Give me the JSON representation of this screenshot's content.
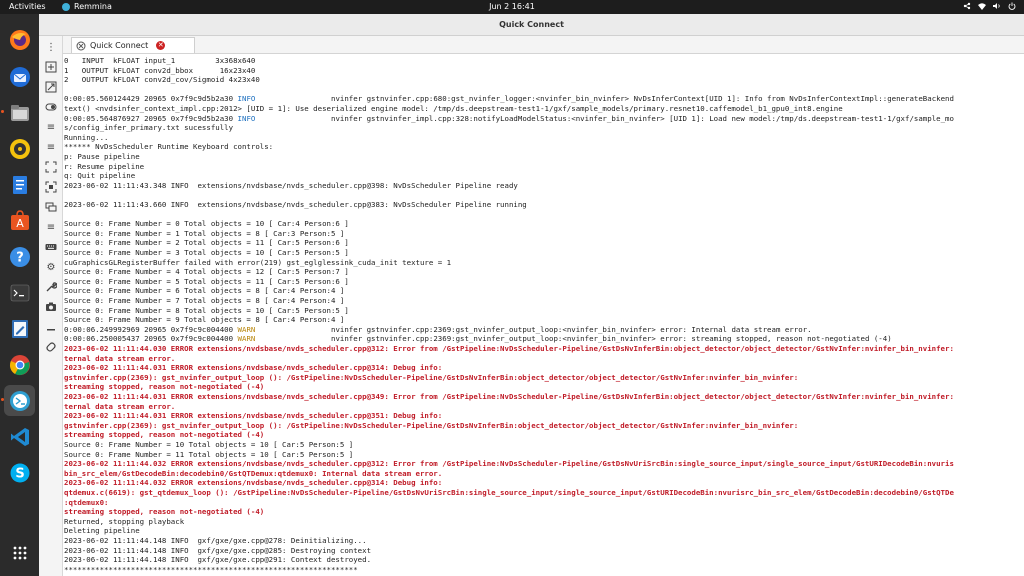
{
  "topbar": {
    "activities": "Activities",
    "app_name": "Remmina",
    "clock": "Jun 2  16:41"
  },
  "window": {
    "title": "Quick Connect",
    "tab_label": "Quick Connect"
  },
  "terminal": {
    "lines": [
      {
        "text": "0   INPUT  kFLOAT input_1         3x368x640",
        "type": "normal"
      },
      {
        "text": "1   OUTPUT kFLOAT conv2d_bbox      16x23x40",
        "type": "normal"
      },
      {
        "text": "2   OUTPUT kFLOAT conv2d_cov/Sigmoid 4x23x40",
        "type": "normal"
      },
      {
        "text": "",
        "type": "normal"
      },
      {
        "text": "0:00:05.560124429 20965 0x7f9c9d5b2a30 ",
        "tag": "INFO",
        "rest": "                 nvinfer gstnvinfer.cpp:680:gst_nvinfer_logger:<nvinfer_bin_nvinfer> NvDsInferContext[UID 1]: Info from NvDsInferContextImpl::generateBackend",
        "type": "tagged"
      },
      {
        "text": "text() <nvdsinfer_context_impl.cpp:2012> [UID = 1]: Use deserialized engine model: /tmp/ds.deepstream-test1-1/gxf/sample_models/primary.resnet10.caffemodel_b1_gpu0_int8.engine",
        "type": "normal"
      },
      {
        "text": "0:00:05.564876927 20965 0x7f9c9d5b2a30 ",
        "tag": "INFO",
        "rest": "                 nvinfer gstnvinfer_impl.cpp:328:notifyLoadModelStatus:<nvinfer_bin_nvinfer> [UID 1]: Load new model:/tmp/ds.deepstream-test1-1/gxf/sample_mo",
        "type": "tagged"
      },
      {
        "text": "s/config_infer_primary.txt sucessfully",
        "type": "normal"
      },
      {
        "text": "Running...",
        "type": "normal"
      },
      {
        "text": "****** NvDsScheduler Runtime Keyboard controls:",
        "type": "normal"
      },
      {
        "text": "p: Pause pipeline",
        "type": "normal"
      },
      {
        "text": "r: Resume pipeline",
        "type": "normal"
      },
      {
        "text": "q: Quit pipeline",
        "type": "normal"
      },
      {
        "text": "2023-06-02 11:11:43.348 INFO  extensions/nvdsbase/nvds_scheduler.cpp@398: NvDsScheduler Pipeline ready",
        "type": "normal"
      },
      {
        "text": "",
        "type": "normal"
      },
      {
        "text": "2023-06-02 11:11:43.660 INFO  extensions/nvdsbase/nvds_scheduler.cpp@383: NvDsScheduler Pipeline running",
        "type": "normal"
      },
      {
        "text": "",
        "type": "normal"
      },
      {
        "text": "Source 0: Frame Number = 0 Total objects = 10 [ Car:4 Person:6 ]",
        "type": "normal"
      },
      {
        "text": "Source 0: Frame Number = 1 Total objects = 8 [ Car:3 Person:5 ]",
        "type": "normal"
      },
      {
        "text": "Source 0: Frame Number = 2 Total objects = 11 [ Car:5 Person:6 ]",
        "type": "normal"
      },
      {
        "text": "Source 0: Frame Number = 3 Total objects = 10 [ Car:5 Person:5 ]",
        "type": "normal"
      },
      {
        "text": "cuGraphicsGLRegisterBuffer failed with error(219) gst_eglglessink_cuda_init texture = 1",
        "type": "normal"
      },
      {
        "text": "Source 0: Frame Number = 4 Total objects = 12 [ Car:5 Person:7 ]",
        "type": "normal"
      },
      {
        "text": "Source 0: Frame Number = 5 Total objects = 11 [ Car:5 Person:6 ]",
        "type": "normal"
      },
      {
        "text": "Source 0: Frame Number = 6 Total objects = 8 [ Car:4 Person:4 ]",
        "type": "normal"
      },
      {
        "text": "Source 0: Frame Number = 7 Total objects = 8 [ Car:4 Person:4 ]",
        "type": "normal"
      },
      {
        "text": "Source 0: Frame Number = 8 Total objects = 10 [ Car:5 Person:5 ]",
        "type": "normal"
      },
      {
        "text": "Source 0: Frame Number = 9 Total objects = 8 [ Car:4 Person:4 ]",
        "type": "normal"
      },
      {
        "text": "0:00:06.249992969 20965 0x7f9c9c004400 ",
        "tag": "WARN",
        "rest": "                 nvinfer gstnvinfer.cpp:2369:gst_nvinfer_output_loop:<nvinfer_bin_nvinfer> error: Internal data stream error.",
        "type": "tagged"
      },
      {
        "text": "0:00:06.250005437 20965 0x7f9c9c004400 ",
        "tag": "WARN",
        "rest": "                 nvinfer gstnvinfer.cpp:2369:gst_nvinfer_output_loop:<nvinfer_bin_nvinfer> error: streaming stopped, reason not-negotiated (-4)",
        "type": "tagged"
      },
      {
        "text": "2023-06-02 11:11:44.030 ERROR extensions/nvdsbase/nvds_scheduler.cpp@312: Error from /GstPipeline:NvDsScheduler-Pipeline/GstDsNvInferBin:object_detector/object_detector/GstNvInfer:nvinfer_bin_nvinfer:",
        "type": "err"
      },
      {
        "text": "ternal data stream error.",
        "type": "err"
      },
      {
        "text": "2023-06-02 11:11:44.031 ERROR extensions/nvdsbase/nvds_scheduler.cpp@314: Debug info:",
        "type": "err"
      },
      {
        "text": "gstnvinfer.cpp(2369): gst_nvinfer_output_loop (): /GstPipeline:NvDsScheduler-Pipeline/GstDsNvInferBin:object_detector/object_detector/GstNvInfer:nvinfer_bin_nvinfer:",
        "type": "err"
      },
      {
        "text": "streaming stopped, reason not-negotiated (-4)",
        "type": "err"
      },
      {
        "text": "2023-06-02 11:11:44.031 ERROR extensions/nvdsbase/nvds_scheduler.cpp@349: Error from /GstPipeline:NvDsScheduler-Pipeline/GstDsNvInferBin:object_detector/object_detector/GstNvInfer:nvinfer_bin_nvinfer:",
        "type": "err"
      },
      {
        "text": "ternal data stream error.",
        "type": "err"
      },
      {
        "text": "2023-06-02 11:11:44.031 ERROR extensions/nvdsbase/nvds_scheduler.cpp@351: Debug info:",
        "type": "err"
      },
      {
        "text": "gstnvinfer.cpp(2369): gst_nvinfer_output_loop (): /GstPipeline:NvDsScheduler-Pipeline/GstDsNvInferBin:object_detector/object_detector/GstNvInfer:nvinfer_bin_nvinfer:",
        "type": "err"
      },
      {
        "text": "streaming stopped, reason not-negotiated (-4)",
        "type": "err"
      },
      {
        "text": "Source 0: Frame Number = 10 Total objects = 10 [ Car:5 Person:5 ]",
        "type": "normal"
      },
      {
        "text": "Source 0: Frame Number = 11 Total objects = 10 [ Car:5 Person:5 ]",
        "type": "normal"
      },
      {
        "text": "2023-06-02 11:11:44.032 ERROR extensions/nvdsbase/nvds_scheduler.cpp@312: Error from /GstPipeline:NvDsScheduler-Pipeline/GstDsNvUriSrcBin:single_source_input/single_source_input/GstURIDecodeBin:nvuris",
        "type": "err"
      },
      {
        "text": "bin_src_elem/GstDecodeBin:decodebin0/GstQTDemux:qtdemux0: Internal data stream error.",
        "type": "err"
      },
      {
        "text": "2023-06-02 11:11:44.032 ERROR extensions/nvdsbase/nvds_scheduler.cpp@314: Debug info:",
        "type": "err"
      },
      {
        "text": "qtdemux.c(6619): gst_qtdemux_loop (): /GstPipeline:NvDsScheduler-Pipeline/GstDsNvUriSrcBin:single_source_input/single_source_input/GstURIDecodeBin:nvurisrc_bin_src_elem/GstDecodeBin:decodebin0/GstQTDe",
        "type": "err"
      },
      {
        "text": ":qtdemux0:",
        "type": "err"
      },
      {
        "text": "streaming stopped, reason not-negotiated (-4)",
        "type": "err"
      },
      {
        "text": "Returned, stopping playback",
        "type": "normal"
      },
      {
        "text": "Deleting pipeline",
        "type": "normal"
      },
      {
        "text": "2023-06-02 11:11:44.148 INFO  gxf/gxe/gxe.cpp@278: Deinitializing...",
        "type": "normal"
      },
      {
        "text": "2023-06-02 11:11:44.148 INFO  gxf/gxe/gxe.cpp@285: Destroying context",
        "type": "normal"
      },
      {
        "text": "2023-06-02 11:11:44.148 INFO  gxf/gxe/gxe.cpp@291: Context destroyed.",
        "type": "normal"
      },
      {
        "text": "******************************************************************",
        "type": "normal"
      }
    ]
  },
  "dock_icons": [
    "firefox-icon",
    "thunderbird-icon",
    "files-icon",
    "rhythmbox-icon",
    "writer-icon",
    "software-icon",
    "help-icon",
    "terminal-icon",
    "text-editor-icon",
    "chrome-icon",
    "remmina-icon",
    "vscode-icon",
    "skype-icon",
    "app-grid-icon"
  ],
  "colors": {
    "topbar_bg": "#1d1d1d",
    "dock_bg": "#2b2b2b",
    "error_red": "#c01c28",
    "warn_yellow": "#b8860b",
    "info_blue": "#1c6fbf"
  }
}
